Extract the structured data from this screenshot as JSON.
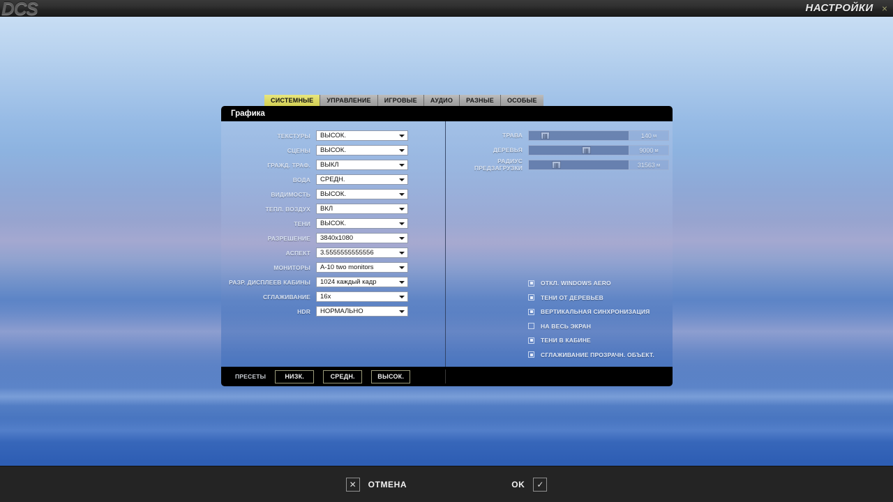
{
  "window": {
    "logo": "DCS",
    "title": "НАСТРОЙКИ",
    "close_icon": "×"
  },
  "tabs": [
    {
      "label": "СИСТЕМНЫЕ",
      "active": true
    },
    {
      "label": "УПРАВЛЕНИЕ",
      "active": false
    },
    {
      "label": "ИГРОВЫЕ",
      "active": false
    },
    {
      "label": "АУДИО",
      "active": false
    },
    {
      "label": "РАЗНЫЕ",
      "active": false
    },
    {
      "label": "ОСОБЫЕ",
      "active": false
    }
  ],
  "dialog": {
    "title": "Графика"
  },
  "settings": [
    {
      "label": "ТЕКСТУРЫ",
      "value": "ВЫСОК."
    },
    {
      "label": "СЦЕНЫ",
      "value": "ВЫСОК."
    },
    {
      "label": "ГРАЖД. ТРАФ.",
      "value": "ВЫКЛ"
    },
    {
      "label": "ВОДА",
      "value": "СРЕДН."
    },
    {
      "label": "ВИДИМОСТЬ",
      "value": "ВЫСОК."
    },
    {
      "label": "ТЕПЛ. ВОЗДУХ",
      "value": "ВКЛ"
    },
    {
      "label": "ТЕНИ",
      "value": "ВЫСОК."
    },
    {
      "label": "РАЗРЕШЕНИЕ",
      "value": "3840x1080"
    },
    {
      "label": "АСПЕКТ",
      "value": "3.5555555555556"
    },
    {
      "label": "МОНИТОРЫ",
      "value": "A-10 two monitors"
    },
    {
      "label": "РАЗР. ДИСПЛЕЕВ КАБИНЫ",
      "value": "1024 каждый кадр"
    },
    {
      "label": "СГЛАЖИВАНИЕ",
      "value": "16x"
    },
    {
      "label": "HDR",
      "value": "НОРМАЛЬНО"
    }
  ],
  "sliders": [
    {
      "label": "ТРАВА",
      "value": "140",
      "unit": "м",
      "percent": 12
    },
    {
      "label": "ДЕРЕВЬЯ",
      "value": "9000",
      "unit": "м",
      "percent": 53
    },
    {
      "label": "РАДИУС ПРЕДЗАГРУЗКИ",
      "value": "31563",
      "unit": "м",
      "percent": 23
    }
  ],
  "checkboxes": [
    {
      "label": "ОТКЛ. WINDOWS AERO",
      "checked": true
    },
    {
      "label": "ТЕНИ ОТ ДЕРЕВЬЕВ",
      "checked": true
    },
    {
      "label": "ВЕРТИКАЛЬНАЯ СИНХРОНИЗАЦИЯ",
      "checked": true
    },
    {
      "label": "НА ВЕСЬ ЭКРАН",
      "checked": false
    },
    {
      "label": "ТЕНИ В КАБИНЕ",
      "checked": true
    },
    {
      "label": "СГЛАЖИВАНИЕ ПРОЗРАЧН. ОБЪЕКТ.",
      "checked": true
    }
  ],
  "presets": {
    "label": "ПРЕСЕТЫ",
    "buttons": [
      "НИЗК.",
      "СРЕДН.",
      "ВЫСОК."
    ]
  },
  "actions": {
    "cancel_label": "ОТМЕНА",
    "cancel_icon": "✕",
    "ok_label": "OK",
    "ok_icon": "✓"
  },
  "colors": {
    "accent_tab": "#dcd965",
    "panel_title_bg": "#000000",
    "preset_border": "#9a9a7a"
  }
}
